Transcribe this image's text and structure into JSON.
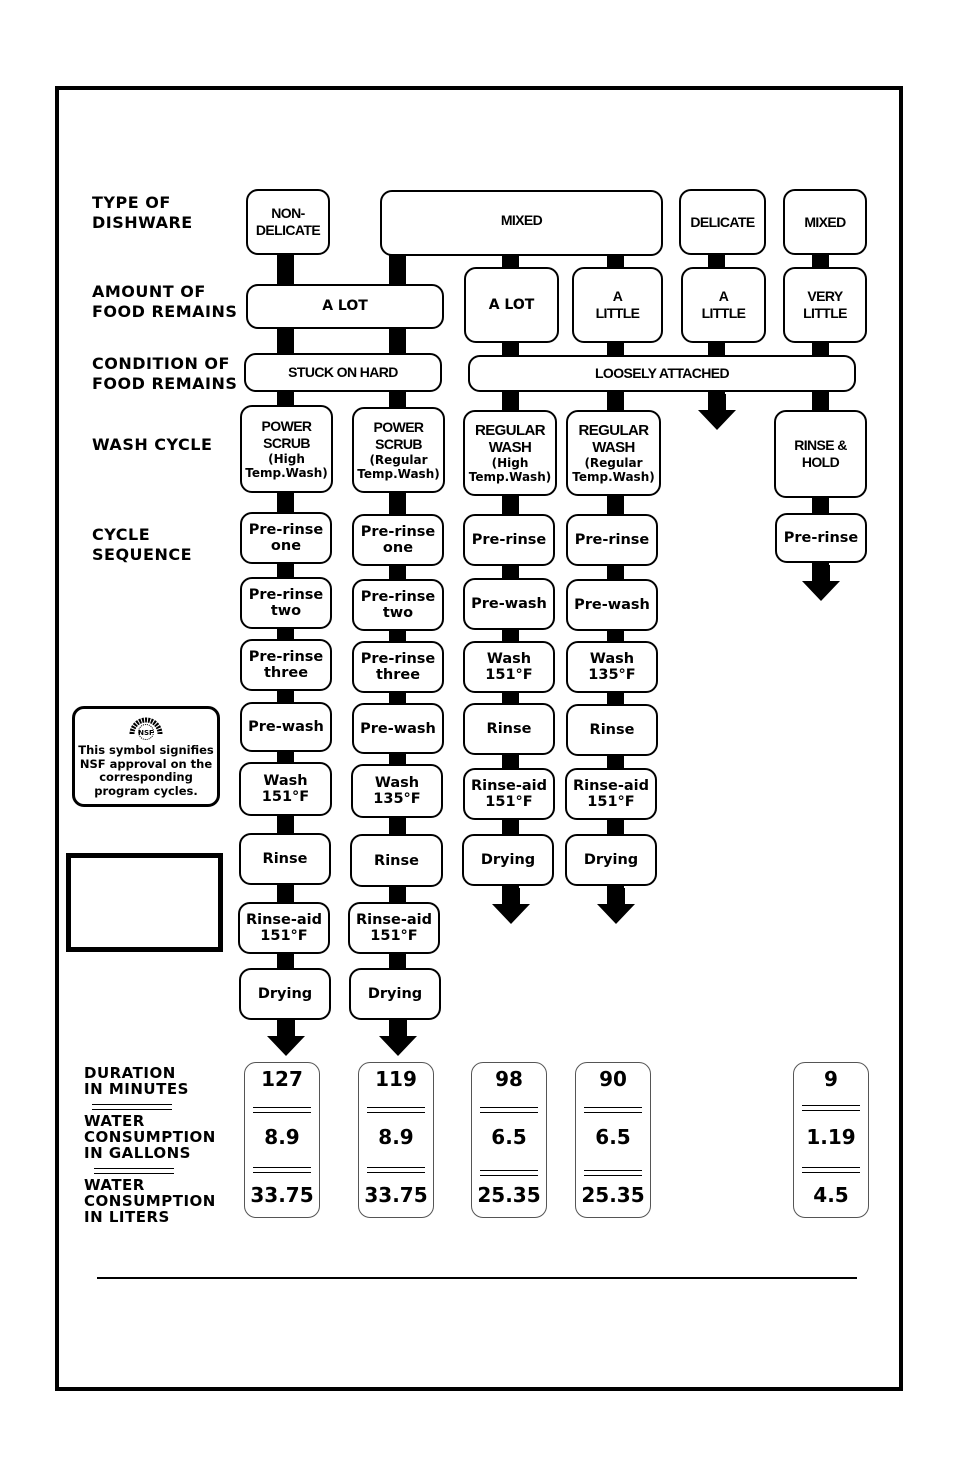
{
  "row_labels": {
    "dishware": "TYPE OF\nDISHWARE",
    "amount": "AMOUNT OF\nFOOD REMAINS",
    "condition": "CONDITION OF\nFOOD REMAINS",
    "wash_cycle": "WASH CYCLE",
    "sequence": "CYCLE\nSEQUENCE",
    "duration": "DURATION\nIN MINUTES",
    "gallons": "WATER\nCONSUMPTION\nIN GALLONS",
    "liters": "WATER\nCONSUMPTION\nIN LITERS"
  },
  "dishware": {
    "non_delicate": "NON-\nDELICATE",
    "mixed_wide": "MIXED",
    "delicate": "DELICATE",
    "mixed_right": "MIXED"
  },
  "amount": {
    "a_lot_wide": "A  LOT",
    "a_lot": "A  LOT",
    "a_little_1": "A\nLITTLE",
    "a_little_2": "A\nLITTLE",
    "very_little": "VERY\nLITTLE"
  },
  "condition": {
    "stuck": "STUCK ON HARD",
    "loose": "LOOSELY ATTACHED"
  },
  "cycles": [
    {
      "name": "POWER\nSCRUB",
      "sub": "(High\nTemp.Wash)",
      "steps": [
        "Pre-rinse\none",
        "Pre-rinse\ntwo",
        "Pre-rinse\nthree",
        "Pre-wash",
        "Wash\n151°F",
        "Rinse",
        "Rinse-aid\n151°F",
        "Drying"
      ],
      "duration": "127",
      "gallons": "8.9",
      "liters": "33.75"
    },
    {
      "name": "POWER\nSCRUB",
      "sub": "(Regular\nTemp.Wash)",
      "steps": [
        "Pre-rinse\none",
        "Pre-rinse\ntwo",
        "Pre-rinse\nthree",
        "Pre-wash",
        "Wash\n135°F",
        "Rinse",
        "Rinse-aid\n151°F",
        "Drying"
      ],
      "duration": "119",
      "gallons": "8.9",
      "liters": "33.75"
    },
    {
      "name": "REGULAR\nWASH",
      "sub": "(High\nTemp.Wash)",
      "steps": [
        "Pre-rinse",
        "Pre-wash",
        "Wash\n151°F",
        "Rinse",
        "Rinse-aid\n151°F",
        "Drying"
      ],
      "duration": "98",
      "gallons": "6.5",
      "liters": "25.35"
    },
    {
      "name": "REGULAR\nWASH",
      "sub": "(Regular\nTemp.Wash)",
      "steps": [
        "Pre-rinse",
        "Pre-wash",
        "Wash\n135°F",
        "Rinse",
        "Rinse-aid\n151°F",
        "Drying"
      ],
      "duration": "90",
      "gallons": "6.5",
      "liters": "25.35"
    },
    {
      "name": "RINSE &\nHOLD",
      "sub": "",
      "steps": [
        "Pre-rinse"
      ],
      "duration": "9",
      "gallons": "1.19",
      "liters": "4.5"
    }
  ],
  "nsf_note": {
    "logo_text": "NSF",
    "text": "This symbol signifies\nNSF approval on the\ncorresponding\nprogram cycles."
  }
}
